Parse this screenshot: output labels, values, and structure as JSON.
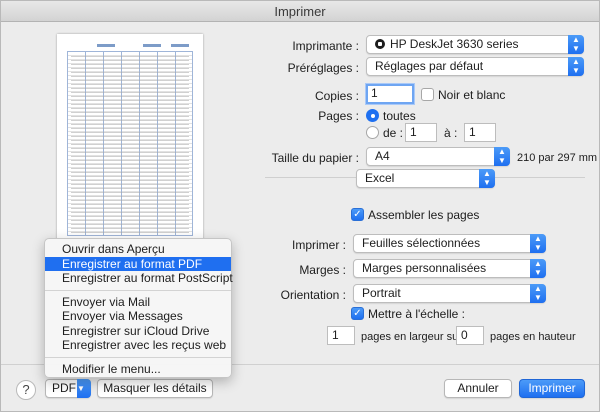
{
  "window": {
    "title": "Imprimer"
  },
  "form": {
    "printer_label": "Imprimante :",
    "printer_value": "HP DeskJet 3630 series",
    "presets_label": "Préréglages :",
    "presets_value": "Réglages par défaut",
    "copies_label": "Copies :",
    "copies_value": "1",
    "bw_label": "Noir et blanc",
    "pages_label": "Pages :",
    "pages_all": "toutes",
    "pages_from_label": "de :",
    "pages_from": "1",
    "pages_to_label": "à :",
    "pages_to": "1",
    "paper_label": "Taille du papier :",
    "paper_value": "A4",
    "paper_dims": "210 par 297 mm",
    "app_section": "Excel",
    "collate_label": "Assembler les pages",
    "print_label": "Imprimer :",
    "print_value": "Feuilles sélectionnées",
    "margins_label": "Marges :",
    "margins_value": "Marges personnalisées",
    "orientation_label": "Orientation :",
    "orientation_value": "Portrait",
    "scale_label": "Mettre à l'échelle :",
    "scale_width": "1",
    "scale_width_label": "pages en largeur sur",
    "scale_height": "0",
    "scale_height_label": "pages en hauteur"
  },
  "bottom": {
    "help": "?",
    "pdf_label": "PDF",
    "hide_details": "Masquer les détails",
    "cancel": "Annuler",
    "print": "Imprimer"
  },
  "pdf_menu": {
    "items": [
      "Ouvrir dans Aperçu",
      "Enregistrer au format PDF",
      "Enregistrer au format PostScript",
      "Envoyer via Mail",
      "Envoyer via Messages",
      "Enregistrer sur iCloud Drive",
      "Enregistrer avec les reçus web",
      "Modifier le menu..."
    ],
    "highlighted_index": 1
  },
  "colors": {
    "accent": "#1f6ff0",
    "window_bg": "#ececec"
  }
}
